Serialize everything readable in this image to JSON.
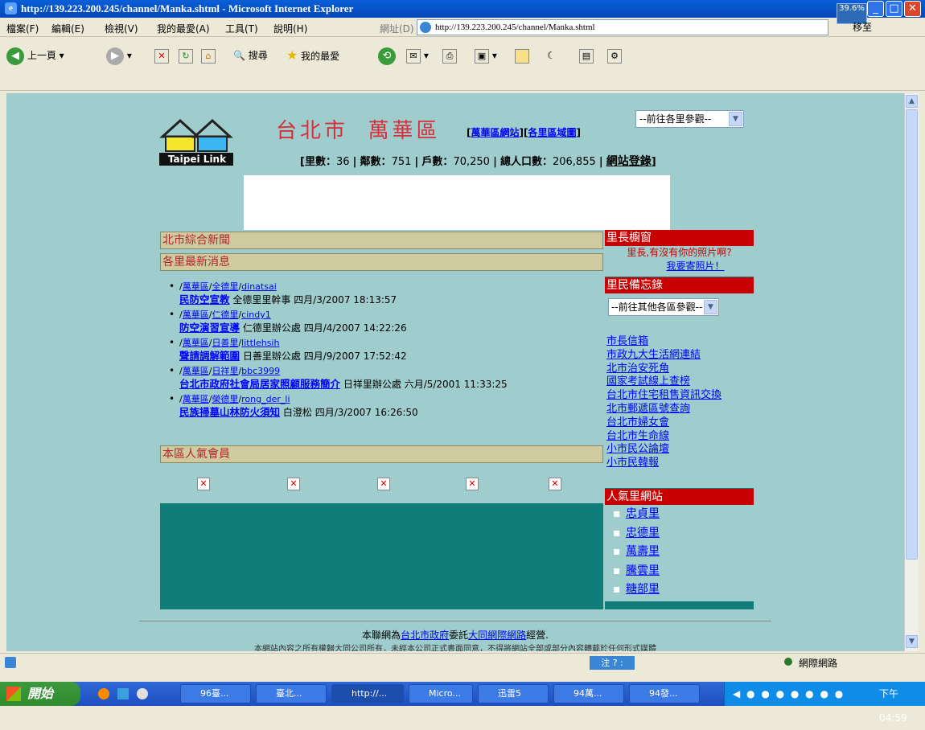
{
  "window": {
    "title": "http://139.223.200.245/channel/Manka.shtml - Microsoft Internet Explorer",
    "zoom_badge": "39.6%",
    "minimize": "_",
    "maximize": "□",
    "close": "✕"
  },
  "menu": {
    "items": [
      "檔案(F)",
      "編輯(E)",
      "檢視(V)",
      "我的最愛(A)",
      "工具(T)",
      "說明(H)"
    ],
    "address_label": "網址(D)",
    "address_value": "http://139.223.200.245/channel/Manka.shtml",
    "go_label": "移至"
  },
  "toolbar": {
    "back": "上一頁",
    "search": "搜尋",
    "favorites": "我的最愛"
  },
  "page": {
    "logo_text": "Taipei Link",
    "title_city": "台北市",
    "title_district": "萬華區",
    "link_district_site": "萬華區網站",
    "link_district_map": "各里區域圖",
    "stats": {
      "villages_label": "里數：",
      "villages": "36",
      "neighborhoods_label": "鄰數：",
      "neighborhoods": "751",
      "households_label": "戶數：",
      "households": "70,250",
      "population_label": "總人口數：",
      "population": "206,855",
      "login": "網站登錄"
    },
    "jump_select": "--前往各里參觀--",
    "sections": {
      "city_news": "北市綜合新聞",
      "village_news": "各里最新消息",
      "popular_members": "本區人氣會員"
    },
    "news": [
      {
        "district": "萬華區",
        "village": "全德里",
        "user": "dinatsai",
        "title": "民防空宣教",
        "publisher": "全德里里幹事",
        "date": "四月/3/2007 18:13:57"
      },
      {
        "district": "萬華區",
        "village": "仁德里",
        "user": "cindy1",
        "title": "防空演習宣導",
        "publisher": "仁德里辦公處",
        "date": "四月/4/2007 14:22:26"
      },
      {
        "district": "萬華區",
        "village": "日善里",
        "user": "littlehsih",
        "title": "聲請調解範圍",
        "publisher": "日善里辦公處",
        "date": "四月/9/2007 17:52:42"
      },
      {
        "district": "萬華區",
        "village": "日祥里",
        "user": "bbc3999",
        "title": "台北市政府社會局居家照顧服務簡介",
        "publisher": "日祥里辦公處",
        "date": "六月/5/2001 11:33:25"
      },
      {
        "district": "萬華區",
        "village": "榮德里",
        "user": "rong_der_li",
        "title": "民族掃墓山林防火須知",
        "publisher": "白澄松",
        "date": "四月/3/2007 16:26:50"
      }
    ],
    "right": {
      "chief_window": "里長櫥窗",
      "chief_prompt": "里長,有沒有你的照片啊?",
      "send_photo": "我要寄照片！",
      "memo": "里民備忘錄",
      "other_district_select": "--前往其他各區參觀--",
      "links": [
        "市長信箱",
        "市政九大生活網連結",
        "北市治安死角",
        "國家考試線上查榜",
        "台北市住宅租售資訊交換",
        "北市郵遞區號查詢",
        "台北市婦女會",
        "台北市生命線",
        "小市民公論壇",
        "小市民韓報"
      ],
      "popular_sites": "人氣里網站",
      "popular": [
        "忠貞里",
        "忠德里",
        "萬壽里",
        "騰雲里",
        "糖部里"
      ]
    },
    "footer": {
      "pre": "本聯網為",
      "gov_link": "台北市政府",
      "mid": "委託",
      "company_link": "大同網際網路",
      "post": "經營.",
      "line2": "本網站內容之所有權歸大同公司所有，未經本公司正式書面同意，不得將網站全部或部分內容轉載於任何形式媒體"
    }
  },
  "status": {
    "zone": "網際網路"
  },
  "taskbar": {
    "start": "開始",
    "items": [
      "96臺...",
      "臺北...",
      "http://...",
      "Micro...",
      "迅雷5",
      "94萬...",
      "94發..."
    ],
    "clock": "下午 04:59"
  }
}
